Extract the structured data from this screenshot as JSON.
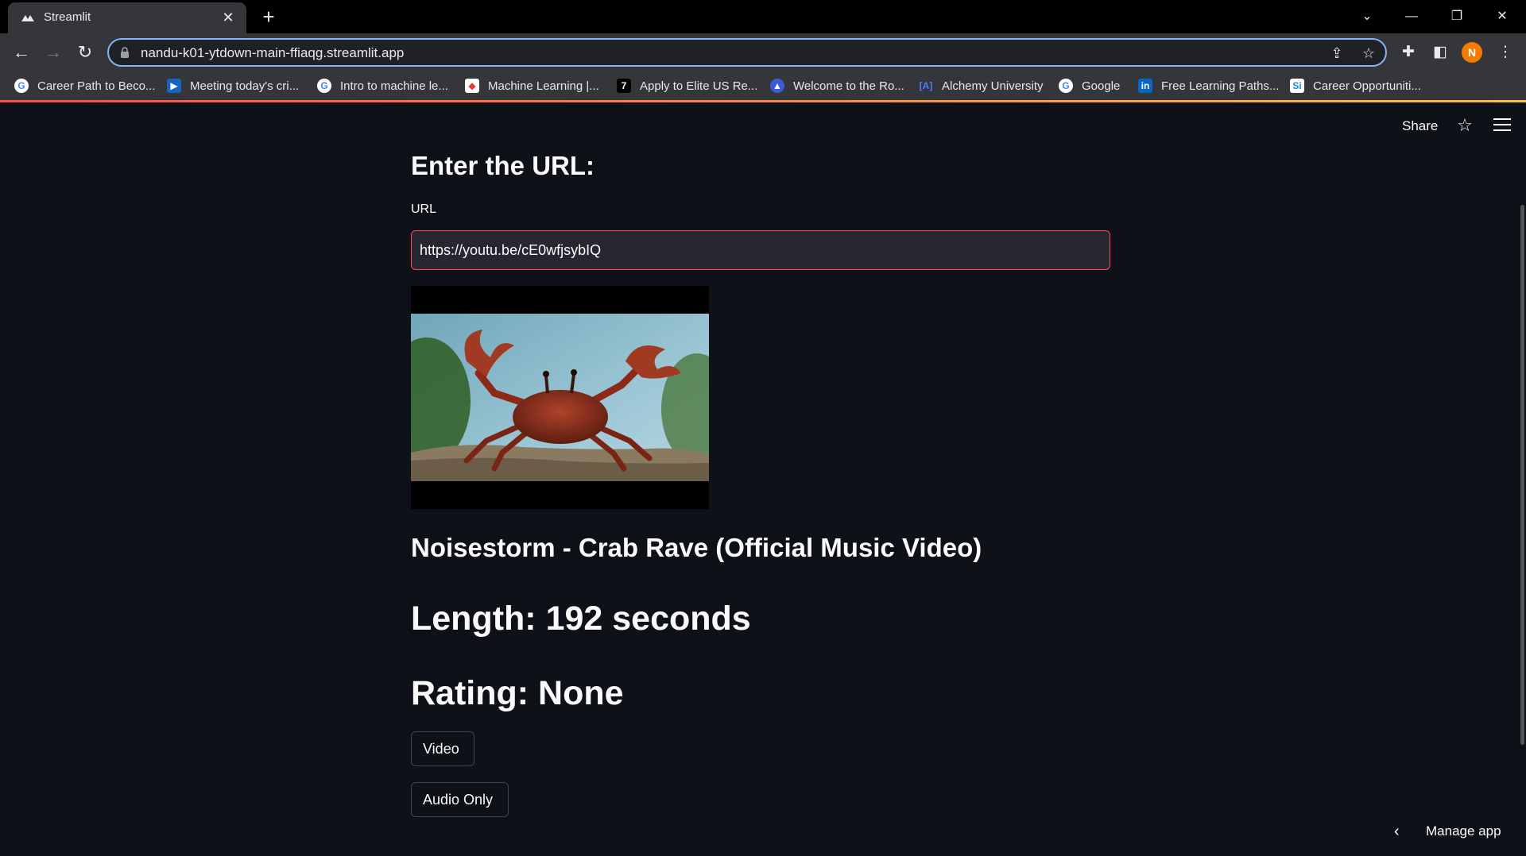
{
  "browser": {
    "tab_title": "Streamlit",
    "url": "nandu-k01-ytdown-main-ffiaqg.streamlit.app",
    "avatar_letter": "N",
    "bookmarks": [
      {
        "label": "Career Path to Beco...",
        "icon": "google-icon",
        "color": "#4285f4"
      },
      {
        "label": "Meeting today's cri...",
        "icon": "play-icon",
        "color": "#1565c0"
      },
      {
        "label": "Intro to machine le...",
        "icon": "google-icon",
        "color": "#4285f4"
      },
      {
        "label": "Machine Learning |...",
        "icon": "ml-icon",
        "color": "#ffffff"
      },
      {
        "label": "Apply to Elite US Re...",
        "icon": "seven-icon",
        "color": "#000000"
      },
      {
        "label": "Welcome to the Ro...",
        "icon": "triangle-icon",
        "color": "#3b5bdb"
      },
      {
        "label": "Alchemy University",
        "icon": "bracket-a-icon",
        "color": "#4f7cff"
      },
      {
        "label": "Google",
        "icon": "google-icon",
        "color": "#4285f4"
      },
      {
        "label": "Free Learning Paths...",
        "icon": "linkedin-icon",
        "color": "#0a66c2"
      },
      {
        "label": "Career Opportuniti...",
        "icon": "si-icon",
        "color": "#1e88e5"
      }
    ]
  },
  "app": {
    "share_label": "Share",
    "heading": "Enter the URL:",
    "input_label": "URL",
    "input_value": "https://youtu.be/cE0wfjsybIQ",
    "video_title": "Noisestorm - Crab Rave (Official Music Video)",
    "length_text": "Length: 192 seconds",
    "rating_text": "Rating: None",
    "buttons": {
      "video": "Video",
      "audio": "Audio Only"
    },
    "manage_label": "Manage app"
  },
  "colors": {
    "accent": "#ff4b4b",
    "background": "#0e1117",
    "input_bg": "#262730"
  }
}
